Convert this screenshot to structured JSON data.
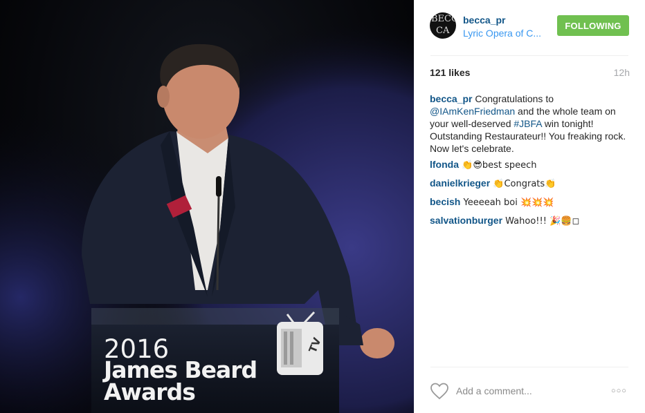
{
  "photo": {
    "podium": {
      "year": "2016",
      "line1": "James Beard",
      "line2": "Awards",
      "tv_logo_top": "TV",
      "tv_logo_bottom": "DINNER"
    }
  },
  "header": {
    "avatar_text": [
      "BECC",
      "CA"
    ],
    "username": "becca_pr",
    "location": "Lyric Opera of C...",
    "follow_label": "FOLLOWING"
  },
  "stats": {
    "likes": "121 likes",
    "time": "12h"
  },
  "caption": {
    "user": "becca_pr",
    "text_1": " Congratulations to ",
    "mention": "@IAmKenFriedman",
    "text_2": " and the whole team on your well-deserved ",
    "hashtag": "#JBFA",
    "text_3": " win tonight! Outstanding Restaurateur!! You freaking rock. Now let's celebrate."
  },
  "comments": [
    {
      "user": "lfonda",
      "text": " 👏😎best speech"
    },
    {
      "user": "danielkrieger",
      "text": " 👏Congrats👏"
    },
    {
      "user": "becish",
      "text": " Yeeeeah boi  💥💥💥"
    },
    {
      "user": "salvationburger",
      "text": " Wahoo!!! 🎉🍔◻"
    }
  ],
  "footer": {
    "comment_placeholder": "Add a comment...",
    "more_label": "○○○"
  },
  "colors": {
    "follow_button": "#70c050",
    "username_link": "#125688",
    "location_link": "#3897f0"
  },
  "icons": [
    "heart-icon",
    "more-options-icon"
  ]
}
